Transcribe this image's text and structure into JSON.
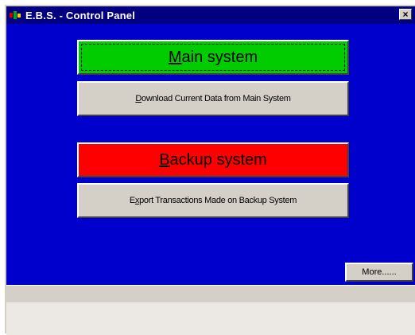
{
  "window": {
    "title": "E.B.S. - Control Panel",
    "background_color": "#0000cc",
    "close_label": "×"
  },
  "buttons": {
    "main_system": {
      "mnemonic": "M",
      "rest": "ain system",
      "color": "#00cc00"
    },
    "download": {
      "mnemonic": "D",
      "rest": "ownload Current Data from Main System",
      "color": "#d4d0c8"
    },
    "backup_system": {
      "mnemonic": "B",
      "rest": "ackup system",
      "color": "#ff0000"
    },
    "export": {
      "pre": "E",
      "mnemonic": "x",
      "rest": "port Transactions Made on Backup System",
      "color": "#d4d0c8"
    },
    "more": {
      "label": "More......"
    }
  },
  "icons": {
    "app": "ebs-app-icon",
    "close": "close-icon"
  }
}
